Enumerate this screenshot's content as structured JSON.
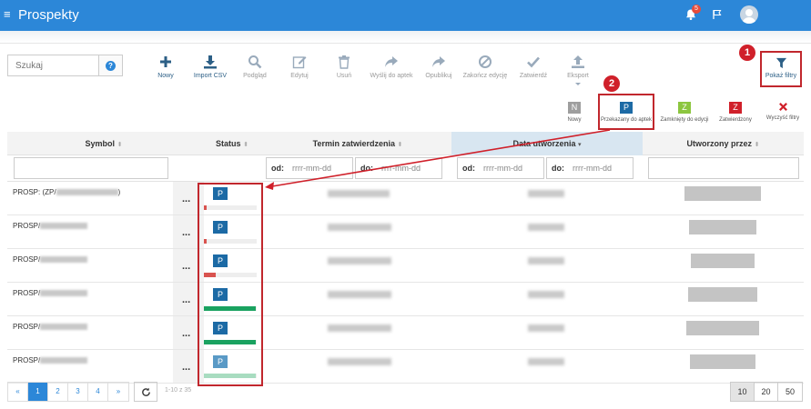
{
  "app": {
    "title": "Prospekty",
    "notification_count": "5"
  },
  "colors": {
    "primary": "#2c87d8",
    "highlight": "#c1272d",
    "status_p": "#1c6aa5"
  },
  "search": {
    "placeholder": "Szukaj",
    "help_icon": "question-icon"
  },
  "toolbar": {
    "new": "Nowy",
    "import_csv": "Import CSV",
    "preview": "Podgląd",
    "edit": "Edytuj",
    "delete": "Usuń",
    "send_to_pharmacies": "Wyślij do aptek",
    "publish": "Opublikuj",
    "end_edit": "Zakończ edycję",
    "approve": "Zatwierdź",
    "export": "Eksport",
    "show_filters": "Pokaż filtry"
  },
  "annotations": {
    "one": "1",
    "two": "2"
  },
  "status_legend": [
    {
      "letter": "N",
      "label": "Nowy",
      "color": "#9e9e9e"
    },
    {
      "letter": "P",
      "label": "Przekazany do aptek",
      "color": "#1c6aa5"
    },
    {
      "letter": "Z",
      "label": "Zamknięty do edycji",
      "color": "#8cc63f"
    },
    {
      "letter": "Z",
      "label": "Zatwierdzony",
      "color": "#d0202a"
    }
  ],
  "clear_filters": "Wyczyść filtry",
  "table": {
    "columns": {
      "symbol": "Symbol",
      "status": "Status",
      "approval_date": "Termin zatwierdzenia",
      "created_date": "Data utworzenia",
      "created_by": "Utworzony przez"
    },
    "filters": {
      "from": "od:",
      "to": "do:",
      "date_placeholder": "rrrr-mm-dd"
    },
    "rows": [
      {
        "symbol": "PROSP: (ZP/",
        "symbol_tail": ")",
        "status": "P",
        "progress": 0.05,
        "progress_color": "#d9534f"
      },
      {
        "symbol": "PROSP/",
        "symbol_tail": "",
        "status": "P",
        "progress": 0.05,
        "progress_color": "#d9534f"
      },
      {
        "symbol": "PROSP/",
        "symbol_tail": "",
        "status": "P",
        "progress": 0.22,
        "progress_color": "#d9534f"
      },
      {
        "symbol": "PROSP/",
        "symbol_tail": "",
        "status": "P",
        "progress": 0.98,
        "progress_color": "#1aa260"
      },
      {
        "symbol": "PROSP/",
        "symbol_tail": "",
        "status": "P",
        "progress": 0.98,
        "progress_color": "#1aa260"
      },
      {
        "symbol": "PROSP/",
        "symbol_tail": "",
        "status": "P",
        "progress": 0.98,
        "progress_color": "#a8dcc0"
      }
    ],
    "row_actions": "..."
  },
  "pagination": {
    "prev": "«",
    "pages": [
      "1",
      "2",
      "3",
      "4"
    ],
    "next": "»",
    "current": "1",
    "count_text": "1-10 z 35",
    "page_sizes": [
      "10",
      "20",
      "50"
    ],
    "current_size": "10"
  }
}
